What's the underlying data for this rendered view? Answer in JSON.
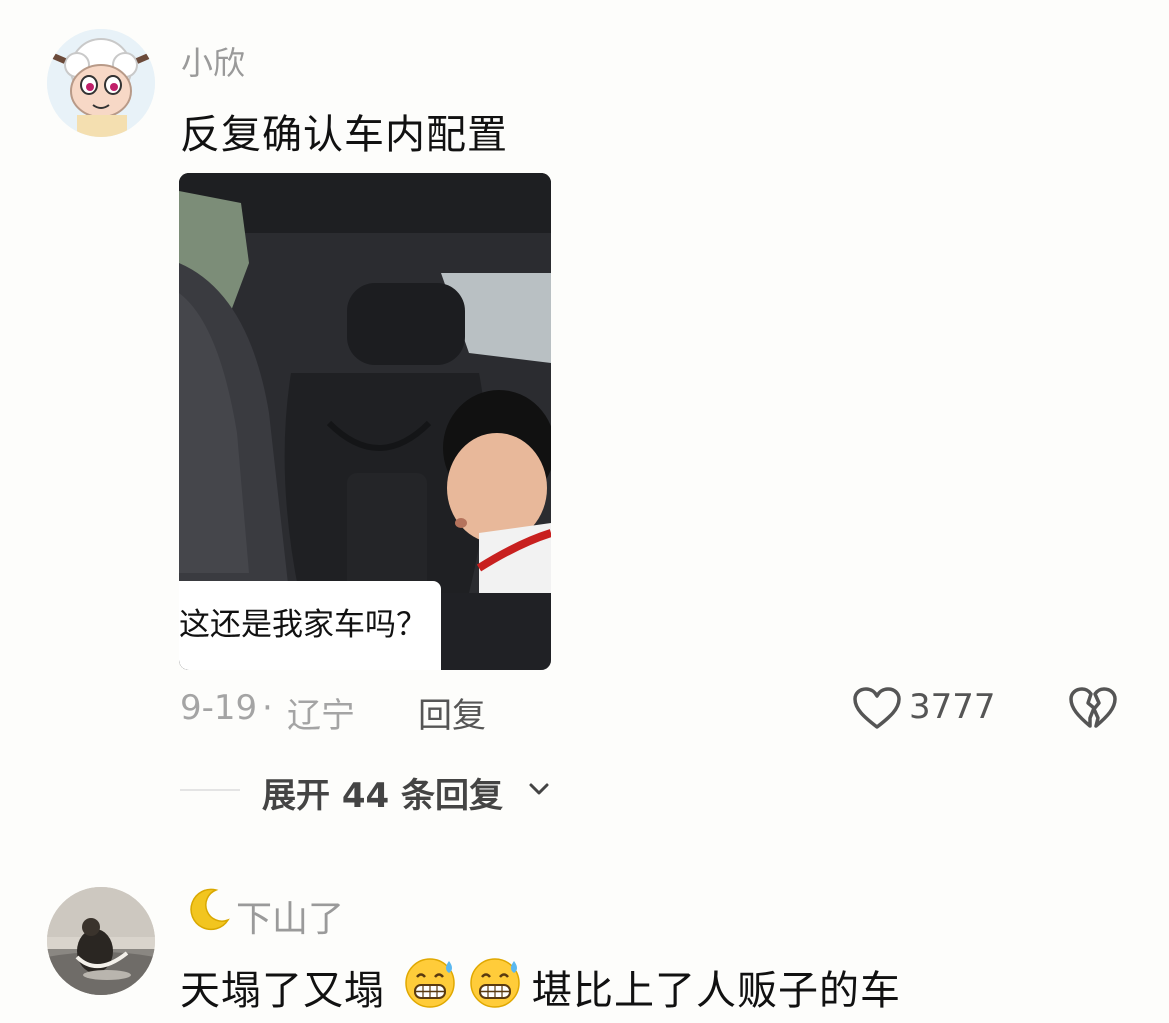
{
  "comment1": {
    "username": "小欣",
    "text": "反复确认车内配置",
    "video_caption": "这还是我家车吗？",
    "date": "9-19",
    "separator": "·",
    "location": "辽宁",
    "reply_label": "回复",
    "like_count": "3777",
    "expand_label": "展开 44 条回复"
  },
  "comment2": {
    "username": "下山了",
    "text_before": "天塌了又塌",
    "text_after": "堪比上了人贩子的车"
  },
  "icons": {
    "like": "heart-outline-icon",
    "dislike": "broken-heart-icon",
    "expand": "chevron-down-icon",
    "moon": "crescent-moon-icon",
    "emoji": "grimacing-sweat-emoji"
  }
}
